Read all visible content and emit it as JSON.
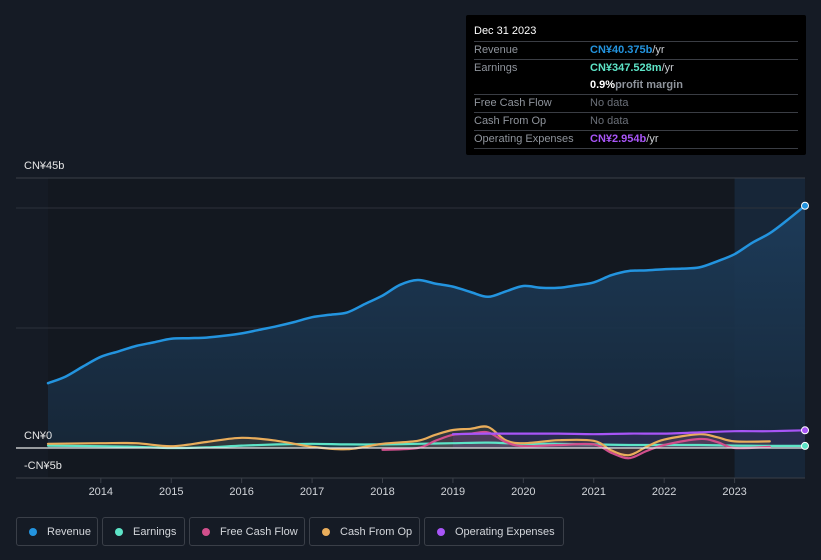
{
  "tooltip": {
    "date": "Dec 31 2023",
    "rows": [
      {
        "label": "Revenue",
        "value": "CN¥40.375b",
        "unit": " /yr",
        "color": "#2394df"
      },
      {
        "label": "Earnings",
        "value": "CN¥347.528m",
        "unit": " /yr",
        "color": "#5de4c7"
      },
      {
        "label": "",
        "value": "0.9%",
        "unit": " profit margin",
        "color": "#ffffff"
      },
      {
        "label": "Free Cash Flow",
        "value": "No data",
        "unit": "",
        "color": "#6b7079"
      },
      {
        "label": "Cash From Op",
        "value": "No data",
        "unit": "",
        "color": "#6b7079"
      },
      {
        "label": "Operating Expenses",
        "value": "CN¥2.954b",
        "unit": " /yr",
        "color": "#a855f7"
      }
    ]
  },
  "legend": [
    {
      "label": "Revenue",
      "color": "#2394df"
    },
    {
      "label": "Earnings",
      "color": "#5de4c7"
    },
    {
      "label": "Free Cash Flow",
      "color": "#d14f8c"
    },
    {
      "label": "Cash From Op",
      "color": "#e9ad5b"
    },
    {
      "label": "Operating Expenses",
      "color": "#a855f7"
    }
  ],
  "chart_data": {
    "type": "line",
    "title": "",
    "xlabel": "",
    "ylabel": "",
    "y_tick_labels": [
      {
        "value": 45,
        "label": "CN¥45b"
      },
      {
        "value": 0,
        "label": "CN¥0"
      },
      {
        "value": -5,
        "label": "-CN¥5b"
      }
    ],
    "ylim": [
      -5,
      45
    ],
    "xlim": [
      2013.25,
      2024.0
    ],
    "x_ticks": [
      2014,
      2015,
      2016,
      2017,
      2018,
      2019,
      2020,
      2021,
      2022,
      2023
    ],
    "gridlines_y": [
      40,
      20
    ],
    "highlight_from": 2023.0,
    "series": [
      {
        "name": "Revenue",
        "color": "#2394df",
        "area": true,
        "x": [
          2013.25,
          2013.5,
          2013.75,
          2014.0,
          2014.25,
          2014.5,
          2014.75,
          2015.0,
          2015.25,
          2015.5,
          2015.75,
          2016.0,
          2016.25,
          2016.5,
          2016.75,
          2017.0,
          2017.25,
          2017.5,
          2017.75,
          2018.0,
          2018.25,
          2018.5,
          2018.75,
          2019.0,
          2019.25,
          2019.5,
          2019.75,
          2020.0,
          2020.25,
          2020.5,
          2020.75,
          2021.0,
          2021.25,
          2021.5,
          2021.75,
          2022.0,
          2022.25,
          2022.5,
          2022.75,
          2023.0,
          2023.25,
          2023.5,
          2023.75,
          2024.0
        ],
        "values": [
          10.8,
          11.9,
          13.6,
          15.2,
          16.1,
          17.0,
          17.6,
          18.2,
          18.3,
          18.4,
          18.7,
          19.1,
          19.7,
          20.3,
          21.0,
          21.8,
          22.2,
          22.6,
          24.0,
          25.4,
          27.2,
          28.0,
          27.4,
          26.9,
          26.0,
          25.2,
          26.1,
          27.0,
          26.7,
          26.7,
          27.1,
          27.6,
          28.8,
          29.5,
          29.6,
          29.8,
          29.9,
          30.1,
          31.1,
          32.3,
          34.2,
          35.8,
          38.0,
          40.375
        ]
      },
      {
        "name": "Earnings",
        "color": "#5de4c7",
        "x": [
          2013.25,
          2014.0,
          2014.5,
          2015.0,
          2015.5,
          2016.0,
          2016.5,
          2017.0,
          2017.5,
          2018.0,
          2018.5,
          2019.0,
          2019.5,
          2020.0,
          2020.5,
          2021.0,
          2021.5,
          2022.0,
          2022.5,
          2023.0,
          2023.5,
          2024.0
        ],
        "values": [
          0.4,
          0.3,
          0.2,
          0.0,
          0.1,
          0.4,
          0.6,
          0.7,
          0.6,
          0.6,
          0.7,
          0.8,
          0.9,
          0.7,
          0.7,
          0.6,
          0.5,
          0.5,
          0.5,
          0.4,
          0.35,
          0.35
        ]
      },
      {
        "name": "Free Cash Flow",
        "color": "#d14f8c",
        "x": [
          2018.0,
          2018.5,
          2018.75,
          2019.0,
          2019.25,
          2019.5,
          2019.75,
          2020.0,
          2020.5,
          2021.0,
          2021.25,
          2021.5,
          2021.75,
          2022.0,
          2022.5,
          2022.75,
          2023.0,
          2023.5
        ],
        "values": [
          -0.3,
          0.0,
          1.2,
          2.2,
          2.4,
          2.6,
          1.0,
          0.3,
          0.5,
          0.6,
          -0.8,
          -1.7,
          -0.5,
          0.5,
          1.5,
          1.0,
          0.0,
          0.2
        ]
      },
      {
        "name": "Cash From Op",
        "color": "#e9ad5b",
        "x": [
          2013.25,
          2014.0,
          2014.5,
          2015.0,
          2015.5,
          2016.0,
          2016.5,
          2017.0,
          2017.5,
          2018.0,
          2018.5,
          2018.75,
          2019.0,
          2019.25,
          2019.5,
          2019.75,
          2020.0,
          2020.5,
          2021.0,
          2021.25,
          2021.5,
          2021.75,
          2022.0,
          2022.5,
          2022.75,
          2023.0,
          2023.5
        ],
        "values": [
          0.7,
          0.8,
          0.8,
          0.3,
          1.0,
          1.7,
          1.2,
          0.2,
          -0.2,
          0.7,
          1.2,
          2.2,
          3.0,
          3.2,
          3.5,
          1.3,
          0.8,
          1.3,
          1.2,
          -0.4,
          -1.2,
          0.2,
          1.4,
          2.3,
          1.8,
          1.1,
          1.1
        ]
      },
      {
        "name": "Operating Expenses",
        "color": "#a855f7",
        "x": [
          2019.0,
          2019.5,
          2020.0,
          2020.5,
          2021.0,
          2021.5,
          2022.0,
          2022.5,
          2023.0,
          2023.5,
          2024.0
        ],
        "values": [
          2.3,
          2.4,
          2.4,
          2.4,
          2.3,
          2.4,
          2.4,
          2.6,
          2.8,
          2.8,
          2.954
        ]
      }
    ]
  }
}
